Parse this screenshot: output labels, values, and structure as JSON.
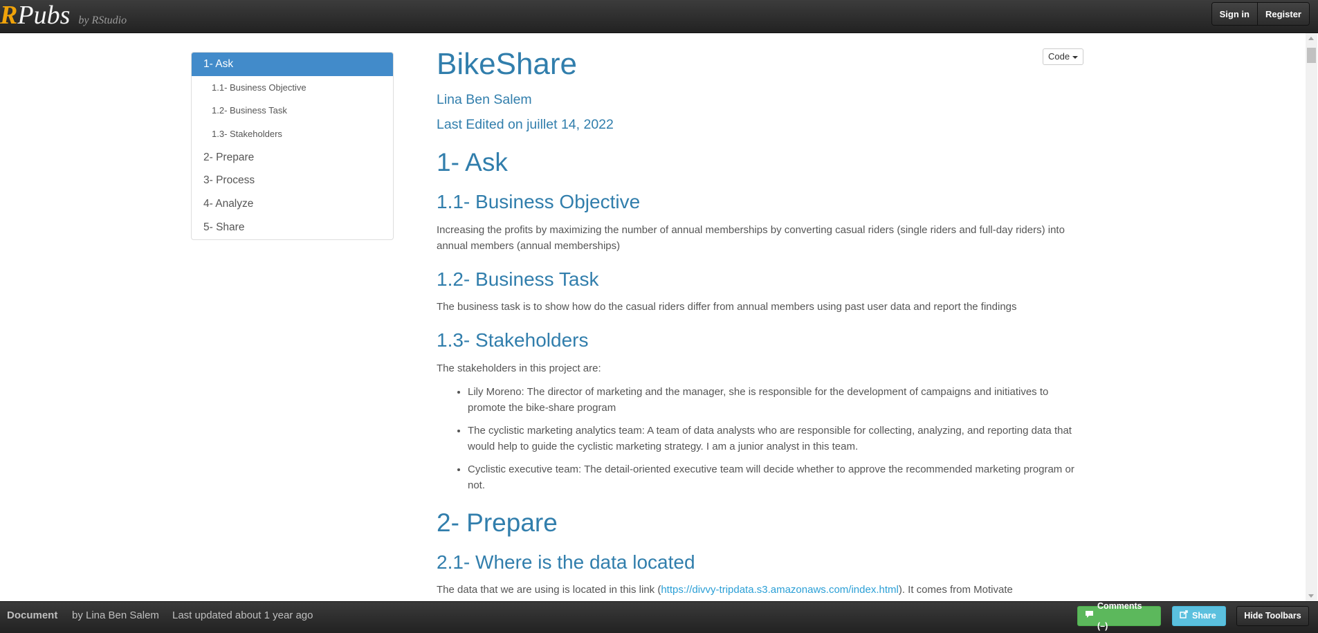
{
  "topbar": {
    "logo_r": "R",
    "logo_pubs": "Pubs",
    "logo_by": "by RStudio",
    "sign_in": "Sign in",
    "register": "Register"
  },
  "toc": {
    "items": [
      {
        "label": "1- Ask",
        "level": 1,
        "active": true
      },
      {
        "label": "1.1- Business Objective",
        "level": 2
      },
      {
        "label": "1.2- Business Task",
        "level": 2
      },
      {
        "label": "1.3- Stakeholders",
        "level": 2
      },
      {
        "label": "2- Prepare",
        "level": 1
      },
      {
        "label": "3- Process",
        "level": 1
      },
      {
        "label": "4- Analyze",
        "level": 1
      },
      {
        "label": "5- Share",
        "level": 1
      }
    ]
  },
  "code_button": "Code",
  "doc": {
    "title": "BikeShare",
    "author": "Lina Ben Salem",
    "date": "Last Edited on juillet 14, 2022",
    "sec1": "1- Ask",
    "sec1_1": "1.1- Business Objective",
    "sec1_1_text": "Increasing the profits by maximizing the number of annual memberships by converting casual riders (single riders and full-day riders) into annual members (annual memberships)",
    "sec1_2": "1.2- Business Task",
    "sec1_2_text": "The business task is to show how do the casual riders differ from annual members using past user data and report the findings",
    "sec1_3": "1.3- Stakeholders",
    "sec1_3_intro": "The stakeholders in this project are:",
    "stakeholders": [
      "Lily Moreno: The director of marketing and the manager, she is responsible for the development of campaigns and initiatives to promote the bike-share program",
      "The cyclistic marketing analytics team: A team of data analysts who are responsible for collecting, analyzing, and reporting data that would help to guide the cyclistic marketing strategy. I am a junior analyst in this team.",
      "Cyclistic executive team: The detail-oriented executive team will decide whether to approve the recommended marketing program or not."
    ],
    "sec2": "2- Prepare",
    "sec2_1": "2.1- Where is the data located",
    "sec2_1_text_before": "The data that we are using is located in this link (",
    "sec2_1_link": "https://divvy-tripdata.s3.amazonaws.com/index.html",
    "sec2_1_text_after": "). It comes from Motivate"
  },
  "bottombar": {
    "doc_label": "Document",
    "by": "by Lina Ben Salem",
    "updated": "Last updated about 1 year ago",
    "comments": "Comments (–)",
    "share": "Share",
    "hide_toolbars": "Hide Toolbars"
  },
  "colors": {
    "accent": "#317eac",
    "toc_active": "#428bca",
    "link": "#2a9fd6",
    "logo_r": "#f0a30a",
    "comments_btn": "#5cb85c",
    "share_btn": "#5bc0de"
  }
}
